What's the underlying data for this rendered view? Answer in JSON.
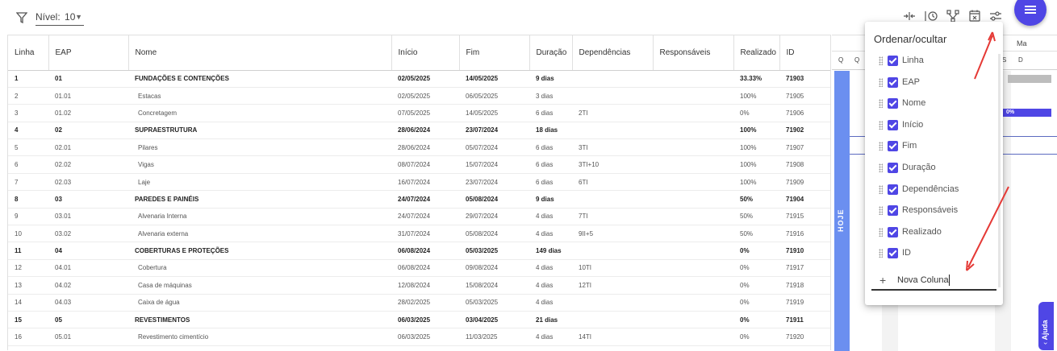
{
  "toolbar": {
    "filter_icon": "filter-icon",
    "nivel_label": "Nível:",
    "nivel_value": "10",
    "icons": [
      "split-columns-icon",
      "history-icon",
      "branch-icon",
      "calendar-x-icon",
      "sliders-icon"
    ],
    "menu_icon": "menu-icon"
  },
  "table": {
    "columns": [
      "Linha",
      "EAP",
      "Nome",
      "Início",
      "Fim",
      "Duração",
      "Dependências",
      "Responsáveis",
      "Realizado",
      "ID"
    ],
    "rows": [
      {
        "linha": "1",
        "eap": "01",
        "nome": "FUNDAÇÕES E CONTENÇÕES",
        "inicio": "02/05/2025",
        "fim": "14/05/2025",
        "duracao": "9 dias",
        "dep": "",
        "resp": "",
        "real": "33.33%",
        "id": "71903",
        "bold": true
      },
      {
        "linha": "2",
        "eap": "01.01",
        "nome": "Estacas",
        "inicio": "02/05/2025",
        "fim": "06/05/2025",
        "duracao": "3 dias",
        "dep": "",
        "resp": "",
        "real": "100%",
        "id": "71905",
        "bold": false
      },
      {
        "linha": "3",
        "eap": "01.02",
        "nome": "Concretagem",
        "inicio": "07/05/2025",
        "fim": "14/05/2025",
        "duracao": "6 dias",
        "dep": "2TI",
        "resp": "",
        "real": "0%",
        "id": "71906",
        "bold": false
      },
      {
        "linha": "4",
        "eap": "02",
        "nome": "SUPRAESTRUTURA",
        "inicio": "28/06/2024",
        "fim": "23/07/2024",
        "duracao": "18 dias",
        "dep": "",
        "resp": "",
        "real": "100%",
        "id": "71902",
        "bold": true
      },
      {
        "linha": "5",
        "eap": "02.01",
        "nome": "Pilares",
        "inicio": "28/06/2024",
        "fim": "05/07/2024",
        "duracao": "6 dias",
        "dep": "3TI",
        "resp": "",
        "real": "100%",
        "id": "71907",
        "bold": false
      },
      {
        "linha": "6",
        "eap": "02.02",
        "nome": "Vigas",
        "inicio": "08/07/2024",
        "fim": "15/07/2024",
        "duracao": "6 dias",
        "dep": "3TI+10",
        "resp": "",
        "real": "100%",
        "id": "71908",
        "bold": false
      },
      {
        "linha": "7",
        "eap": "02.03",
        "nome": "Laje",
        "inicio": "16/07/2024",
        "fim": "23/07/2024",
        "duracao": "6 dias",
        "dep": "6TI",
        "resp": "",
        "real": "100%",
        "id": "71909",
        "bold": false
      },
      {
        "linha": "8",
        "eap": "03",
        "nome": "PAREDES E PAINÉIS",
        "inicio": "24/07/2024",
        "fim": "05/08/2024",
        "duracao": "9 dias",
        "dep": "",
        "resp": "",
        "real": "50%",
        "id": "71904",
        "bold": true
      },
      {
        "linha": "9",
        "eap": "03.01",
        "nome": "Alvenaria Interna",
        "inicio": "24/07/2024",
        "fim": "29/07/2024",
        "duracao": "4 dias",
        "dep": "7TI",
        "resp": "",
        "real": "50%",
        "id": "71915",
        "bold": false
      },
      {
        "linha": "10",
        "eap": "03.02",
        "nome": "Alvenaria externa",
        "inicio": "31/07/2024",
        "fim": "05/08/2024",
        "duracao": "4 dias",
        "dep": "9II+5",
        "resp": "",
        "real": "50%",
        "id": "71916",
        "bold": false
      },
      {
        "linha": "11",
        "eap": "04",
        "nome": "COBERTURAS E PROTEÇÕES",
        "inicio": "06/08/2024",
        "fim": "05/03/2025",
        "duracao": "149 dias",
        "dep": "",
        "resp": "",
        "real": "0%",
        "id": "71910",
        "bold": true
      },
      {
        "linha": "12",
        "eap": "04.01",
        "nome": "Cobertura",
        "inicio": "06/08/2024",
        "fim": "09/08/2024",
        "duracao": "4 dias",
        "dep": "10TI",
        "resp": "",
        "real": "0%",
        "id": "71917",
        "bold": false
      },
      {
        "linha": "13",
        "eap": "04.02",
        "nome": "Casa de máquinas",
        "inicio": "12/08/2024",
        "fim": "15/08/2024",
        "duracao": "4 dias",
        "dep": "12TI",
        "resp": "",
        "real": "0%",
        "id": "71918",
        "bold": false
      },
      {
        "linha": "14",
        "eap": "04.03",
        "nome": "Caixa de água",
        "inicio": "28/02/2025",
        "fim": "05/03/2025",
        "duracao": "4 dias",
        "dep": "",
        "resp": "",
        "real": "0%",
        "id": "71919",
        "bold": false
      },
      {
        "linha": "15",
        "eap": "05",
        "nome": "REVESTIMENTOS",
        "inicio": "06/03/2025",
        "fim": "03/04/2025",
        "duracao": "21 dias",
        "dep": "",
        "resp": "",
        "real": "0%",
        "id": "71911",
        "bold": true
      },
      {
        "linha": "16",
        "eap": "05.01",
        "nome": "Revestimento cimentício",
        "inicio": "06/03/2025",
        "fim": "11/03/2025",
        "duracao": "4 dias",
        "dep": "14TI",
        "resp": "",
        "real": "0%",
        "id": "71920",
        "bold": false
      }
    ]
  },
  "gantt": {
    "month_label": "Ma",
    "day_labels": [
      "Q",
      "Q",
      "S",
      "D"
    ],
    "today_label": "HOJE",
    "bar_label": "0%"
  },
  "popup": {
    "title": "Ordenar/ocultar",
    "options": [
      {
        "label": "Linha",
        "checked": true
      },
      {
        "label": "EAP",
        "checked": true
      },
      {
        "label": "Nome",
        "checked": true
      },
      {
        "label": "Início",
        "checked": true
      },
      {
        "label": "Fim",
        "checked": true
      },
      {
        "label": "Duração",
        "checked": true
      },
      {
        "label": "Dependências",
        "checked": true
      },
      {
        "label": "Responsáveis",
        "checked": true
      },
      {
        "label": "Realizado",
        "checked": true
      },
      {
        "label": "ID",
        "checked": true
      }
    ],
    "new_column_value": "Nova Coluna"
  },
  "help": {
    "label": "Ajuda"
  },
  "colors": {
    "accent": "#4f46e5",
    "today": "#6b8ff0",
    "arrow": "#e53935"
  }
}
